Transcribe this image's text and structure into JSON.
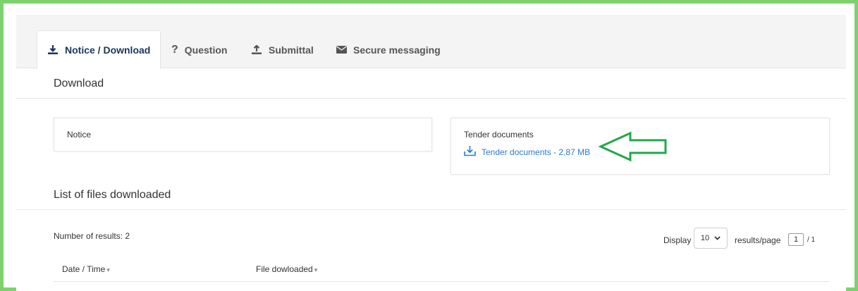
{
  "tabs": [
    {
      "label": "Notice / Download",
      "icon": "download-icon",
      "active": true
    },
    {
      "label": "Question",
      "icon": "question-icon",
      "active": false
    },
    {
      "label": "Submittal",
      "icon": "upload-icon",
      "active": false
    },
    {
      "label": "Secure messaging",
      "icon": "envelope-icon",
      "active": false
    }
  ],
  "download": {
    "title": "Download",
    "notice_label": "Notice",
    "tender_label": "Tender documents",
    "tender_link": "Tender documents - 2,87 MB"
  },
  "files": {
    "title": "List of files downloaded",
    "results_count": "Number of results: 2",
    "display_label": "Display",
    "page_size": "10",
    "results_per_page": "results/page",
    "current_page": "1",
    "total_pages": "/ 1",
    "columns": [
      "Date / Time",
      "File dowloaded"
    ]
  },
  "colors": {
    "frame": "#7fd16f",
    "link": "#2b7bd0",
    "active_tab": "#17365d",
    "annotation_arrow": "#22a84a"
  }
}
